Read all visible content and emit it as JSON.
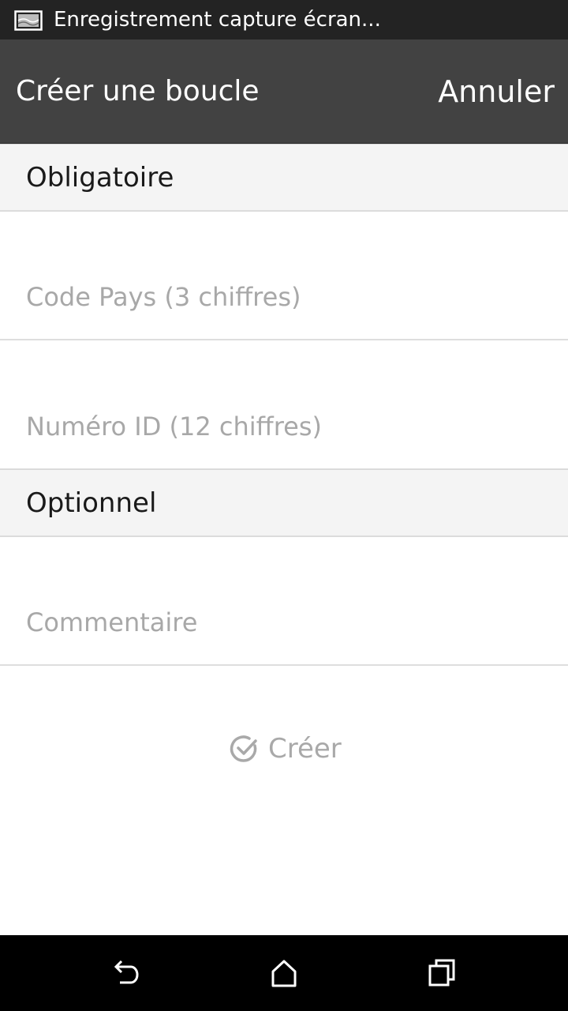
{
  "status_bar": {
    "notification_text": "Enregistrement capture écran...",
    "icon": "screen-recording-icon"
  },
  "action_bar": {
    "title": "Créer une boucle",
    "cancel_label": "Annuler"
  },
  "sections": {
    "required": {
      "title": "Obligatoire",
      "country_code_placeholder": "Code Pays (3 chiffres)",
      "id_number_placeholder": "Numéro ID (12 chiffres)"
    },
    "optional": {
      "title": "Optionnel",
      "comment_placeholder": "Commentaire"
    }
  },
  "create_button": {
    "label": "Créer",
    "icon": "check-circle-icon",
    "color": "#a9a9a9"
  },
  "nav_bar": {
    "back_icon": "back-icon",
    "home_icon": "home-icon",
    "recents_icon": "recents-icon"
  }
}
